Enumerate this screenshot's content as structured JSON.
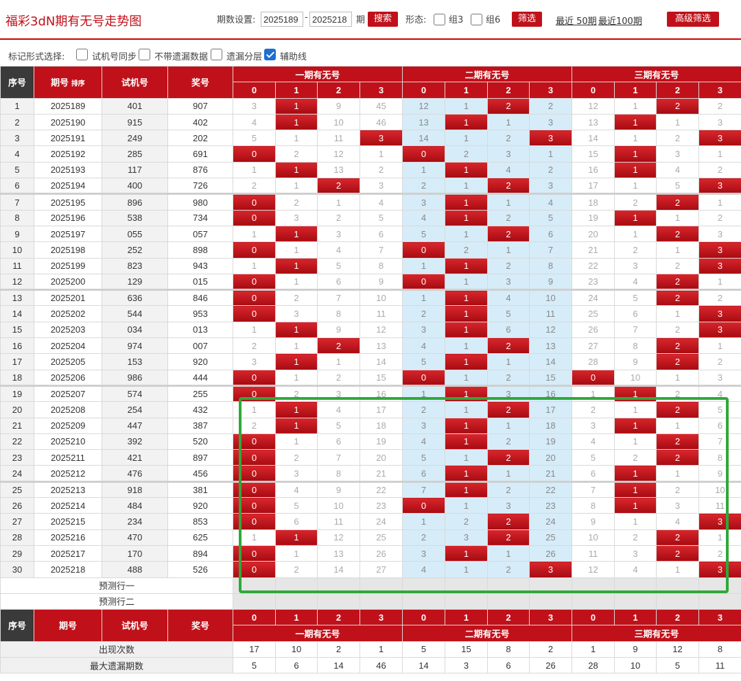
{
  "header": {
    "title": "福彩3dN期有无号走势图",
    "period_label": "期数设置:",
    "period_from": "2025189",
    "period_to": "2025218",
    "period_unit": "期",
    "search_label": "搜索",
    "form_label": "形态:",
    "group3_label": "组3",
    "group6_label": "组6",
    "filter_label": "筛选",
    "recent50_label": "最近 50期",
    "recent100_label": "最近100期",
    "advanced_label": "高级筛选"
  },
  "options": {
    "label": "标记形式选择:",
    "items": [
      {
        "label": "试机号同步",
        "checked": false
      },
      {
        "label": "不带遗漏数据",
        "checked": false
      },
      {
        "label": "遗漏分层",
        "checked": false
      },
      {
        "label": "辅助线",
        "checked": true
      }
    ]
  },
  "table": {
    "headers": {
      "seq": "序号",
      "period": "期号",
      "sort_label": "排序",
      "test": "试机号",
      "prize": "奖号",
      "groups": [
        "一期有无号",
        "二期有无号",
        "三期有无号"
      ],
      "digits": [
        "0",
        "1",
        "2",
        "3"
      ]
    },
    "rows": [
      {
        "seq": "1",
        "period": "2025189",
        "test": "401",
        "prize": "907",
        "cells": [
          "3",
          "1",
          "9",
          "45",
          "12",
          "1",
          "2",
          "2",
          "12",
          "1",
          "2",
          "2"
        ],
        "hits": [
          1,
          6,
          10
        ]
      },
      {
        "seq": "2",
        "period": "2025190",
        "test": "915",
        "prize": "402",
        "cells": [
          "4",
          "1",
          "10",
          "46",
          "13",
          "1",
          "1",
          "3",
          "13",
          "1",
          "1",
          "3"
        ],
        "hits": [
          1,
          5,
          9
        ]
      },
      {
        "seq": "3",
        "period": "2025191",
        "test": "249",
        "prize": "202",
        "cells": [
          "5",
          "1",
          "11",
          "3",
          "14",
          "1",
          "2",
          "3",
          "14",
          "1",
          "2",
          "3"
        ],
        "hits": [
          3,
          7,
          11
        ]
      },
      {
        "seq": "4",
        "period": "2025192",
        "test": "285",
        "prize": "691",
        "cells": [
          "0",
          "2",
          "12",
          "1",
          "0",
          "2",
          "3",
          "1",
          "15",
          "1",
          "3",
          "1"
        ],
        "hits": [
          0,
          4,
          9
        ]
      },
      {
        "seq": "5",
        "period": "2025193",
        "test": "117",
        "prize": "876",
        "cells": [
          "1",
          "1",
          "13",
          "2",
          "1",
          "1",
          "4",
          "2",
          "16",
          "1",
          "4",
          "2"
        ],
        "hits": [
          1,
          5,
          9
        ]
      },
      {
        "seq": "6",
        "period": "2025194",
        "test": "400",
        "prize": "726",
        "cells": [
          "2",
          "1",
          "2",
          "3",
          "2",
          "1",
          "2",
          "3",
          "17",
          "1",
          "5",
          "3"
        ],
        "hits": [
          2,
          6,
          11
        ]
      },
      {
        "seq": "7",
        "period": "2025195",
        "test": "896",
        "prize": "980",
        "cells": [
          "0",
          "2",
          "1",
          "4",
          "3",
          "1",
          "1",
          "4",
          "18",
          "2",
          "2",
          "1"
        ],
        "hits": [
          0,
          5,
          10
        ]
      },
      {
        "seq": "8",
        "period": "2025196",
        "test": "538",
        "prize": "734",
        "cells": [
          "0",
          "3",
          "2",
          "5",
          "4",
          "1",
          "2",
          "5",
          "19",
          "1",
          "1",
          "2"
        ],
        "hits": [
          0,
          5,
          9
        ]
      },
      {
        "seq": "9",
        "period": "2025197",
        "test": "055",
        "prize": "057",
        "cells": [
          "1",
          "1",
          "3",
          "6",
          "5",
          "1",
          "2",
          "6",
          "20",
          "1",
          "2",
          "3"
        ],
        "hits": [
          1,
          6,
          10
        ]
      },
      {
        "seq": "10",
        "period": "2025198",
        "test": "252",
        "prize": "898",
        "cells": [
          "0",
          "1",
          "4",
          "7",
          "0",
          "2",
          "1",
          "7",
          "21",
          "2",
          "1",
          "3"
        ],
        "hits": [
          0,
          4,
          11
        ]
      },
      {
        "seq": "11",
        "period": "2025199",
        "test": "823",
        "prize": "943",
        "cells": [
          "1",
          "1",
          "5",
          "8",
          "1",
          "1",
          "2",
          "8",
          "22",
          "3",
          "2",
          "3"
        ],
        "hits": [
          1,
          5,
          11
        ]
      },
      {
        "seq": "12",
        "period": "2025200",
        "test": "129",
        "prize": "015",
        "cells": [
          "0",
          "1",
          "6",
          "9",
          "0",
          "1",
          "3",
          "9",
          "23",
          "4",
          "2",
          "1"
        ],
        "hits": [
          0,
          4,
          10
        ]
      },
      {
        "seq": "13",
        "period": "2025201",
        "test": "636",
        "prize": "846",
        "cells": [
          "0",
          "2",
          "7",
          "10",
          "1",
          "1",
          "4",
          "10",
          "24",
          "5",
          "2",
          "2"
        ],
        "hits": [
          0,
          5,
          10
        ]
      },
      {
        "seq": "14",
        "period": "2025202",
        "test": "544",
        "prize": "953",
        "cells": [
          "0",
          "3",
          "8",
          "11",
          "2",
          "1",
          "5",
          "11",
          "25",
          "6",
          "1",
          "3"
        ],
        "hits": [
          0,
          5,
          11
        ]
      },
      {
        "seq": "15",
        "period": "2025203",
        "test": "034",
        "prize": "013",
        "cells": [
          "1",
          "1",
          "9",
          "12",
          "3",
          "1",
          "6",
          "12",
          "26",
          "7",
          "2",
          "3"
        ],
        "hits": [
          1,
          5,
          11
        ]
      },
      {
        "seq": "16",
        "period": "2025204",
        "test": "974",
        "prize": "007",
        "cells": [
          "2",
          "1",
          "2",
          "13",
          "4",
          "1",
          "2",
          "13",
          "27",
          "8",
          "2",
          "1"
        ],
        "hits": [
          2,
          6,
          10
        ]
      },
      {
        "seq": "17",
        "period": "2025205",
        "test": "153",
        "prize": "920",
        "cells": [
          "3",
          "1",
          "1",
          "14",
          "5",
          "1",
          "1",
          "14",
          "28",
          "9",
          "2",
          "2"
        ],
        "hits": [
          1,
          5,
          10
        ]
      },
      {
        "seq": "18",
        "period": "2025206",
        "test": "986",
        "prize": "444",
        "cells": [
          "0",
          "1",
          "2",
          "15",
          "0",
          "1",
          "2",
          "15",
          "0",
          "10",
          "1",
          "3"
        ],
        "hits": [
          0,
          4,
          8
        ]
      },
      {
        "seq": "19",
        "period": "2025207",
        "test": "574",
        "prize": "255",
        "cells": [
          "0",
          "2",
          "3",
          "16",
          "1",
          "1",
          "3",
          "16",
          "1",
          "1",
          "2",
          "4"
        ],
        "hits": [
          0,
          5,
          9
        ]
      },
      {
        "seq": "20",
        "period": "2025208",
        "test": "254",
        "prize": "432",
        "cells": [
          "1",
          "1",
          "4",
          "17",
          "2",
          "1",
          "2",
          "17",
          "2",
          "1",
          "2",
          "5"
        ],
        "hits": [
          1,
          6,
          10
        ]
      },
      {
        "seq": "21",
        "period": "2025209",
        "test": "447",
        "prize": "387",
        "cells": [
          "2",
          "1",
          "5",
          "18",
          "3",
          "1",
          "1",
          "18",
          "3",
          "1",
          "1",
          "6"
        ],
        "hits": [
          1,
          5,
          9
        ]
      },
      {
        "seq": "22",
        "period": "2025210",
        "test": "392",
        "prize": "520",
        "cells": [
          "0",
          "1",
          "6",
          "19",
          "4",
          "1",
          "2",
          "19",
          "4",
          "1",
          "2",
          "7"
        ],
        "hits": [
          0,
          5,
          10
        ]
      },
      {
        "seq": "23",
        "period": "2025211",
        "test": "421",
        "prize": "897",
        "cells": [
          "0",
          "2",
          "7",
          "20",
          "5",
          "1",
          "2",
          "20",
          "5",
          "2",
          "2",
          "8"
        ],
        "hits": [
          0,
          6,
          10
        ]
      },
      {
        "seq": "24",
        "period": "2025212",
        "test": "476",
        "prize": "456",
        "cells": [
          "0",
          "3",
          "8",
          "21",
          "6",
          "1",
          "1",
          "21",
          "6",
          "1",
          "1",
          "9"
        ],
        "hits": [
          0,
          5,
          9
        ]
      },
      {
        "seq": "25",
        "period": "2025213",
        "test": "918",
        "prize": "381",
        "cells": [
          "0",
          "4",
          "9",
          "22",
          "7",
          "1",
          "2",
          "22",
          "7",
          "1",
          "2",
          "10"
        ],
        "hits": [
          0,
          5,
          9
        ]
      },
      {
        "seq": "26",
        "period": "2025214",
        "test": "484",
        "prize": "920",
        "cells": [
          "0",
          "5",
          "10",
          "23",
          "0",
          "1",
          "3",
          "23",
          "8",
          "1",
          "3",
          "11"
        ],
        "hits": [
          0,
          4,
          9
        ]
      },
      {
        "seq": "27",
        "period": "2025215",
        "test": "234",
        "prize": "853",
        "cells": [
          "0",
          "6",
          "11",
          "24",
          "1",
          "2",
          "2",
          "24",
          "9",
          "1",
          "4",
          "3"
        ],
        "hits": [
          0,
          6,
          11
        ]
      },
      {
        "seq": "28",
        "period": "2025216",
        "test": "470",
        "prize": "625",
        "cells": [
          "1",
          "1",
          "12",
          "25",
          "2",
          "3",
          "2",
          "25",
          "10",
          "2",
          "2",
          "1"
        ],
        "hits": [
          1,
          6,
          10
        ]
      },
      {
        "seq": "29",
        "period": "2025217",
        "test": "170",
        "prize": "894",
        "cells": [
          "0",
          "1",
          "13",
          "26",
          "3",
          "1",
          "1",
          "26",
          "11",
          "3",
          "2",
          "2"
        ],
        "hits": [
          0,
          5,
          10
        ]
      },
      {
        "seq": "30",
        "period": "2025218",
        "test": "488",
        "prize": "526",
        "cells": [
          "0",
          "2",
          "14",
          "27",
          "4",
          "1",
          "2",
          "3",
          "12",
          "4",
          "1",
          "3"
        ],
        "hits": [
          0,
          7,
          11
        ]
      }
    ],
    "predict": [
      "预测行一",
      "预测行二"
    ],
    "stats": [
      {
        "label": "出现次数",
        "values": [
          "17",
          "10",
          "2",
          "1",
          "5",
          "15",
          "8",
          "2",
          "1",
          "9",
          "12",
          "8"
        ]
      },
      {
        "label": "最大遗漏期数",
        "values": [
          "5",
          "6",
          "14",
          "46",
          "14",
          "3",
          "6",
          "26",
          "28",
          "10",
          "5",
          "11"
        ]
      }
    ]
  },
  "colors": {
    "accent": "#c0111a",
    "highlight": "#2fa83a",
    "zone2": "#d6ecf8"
  }
}
